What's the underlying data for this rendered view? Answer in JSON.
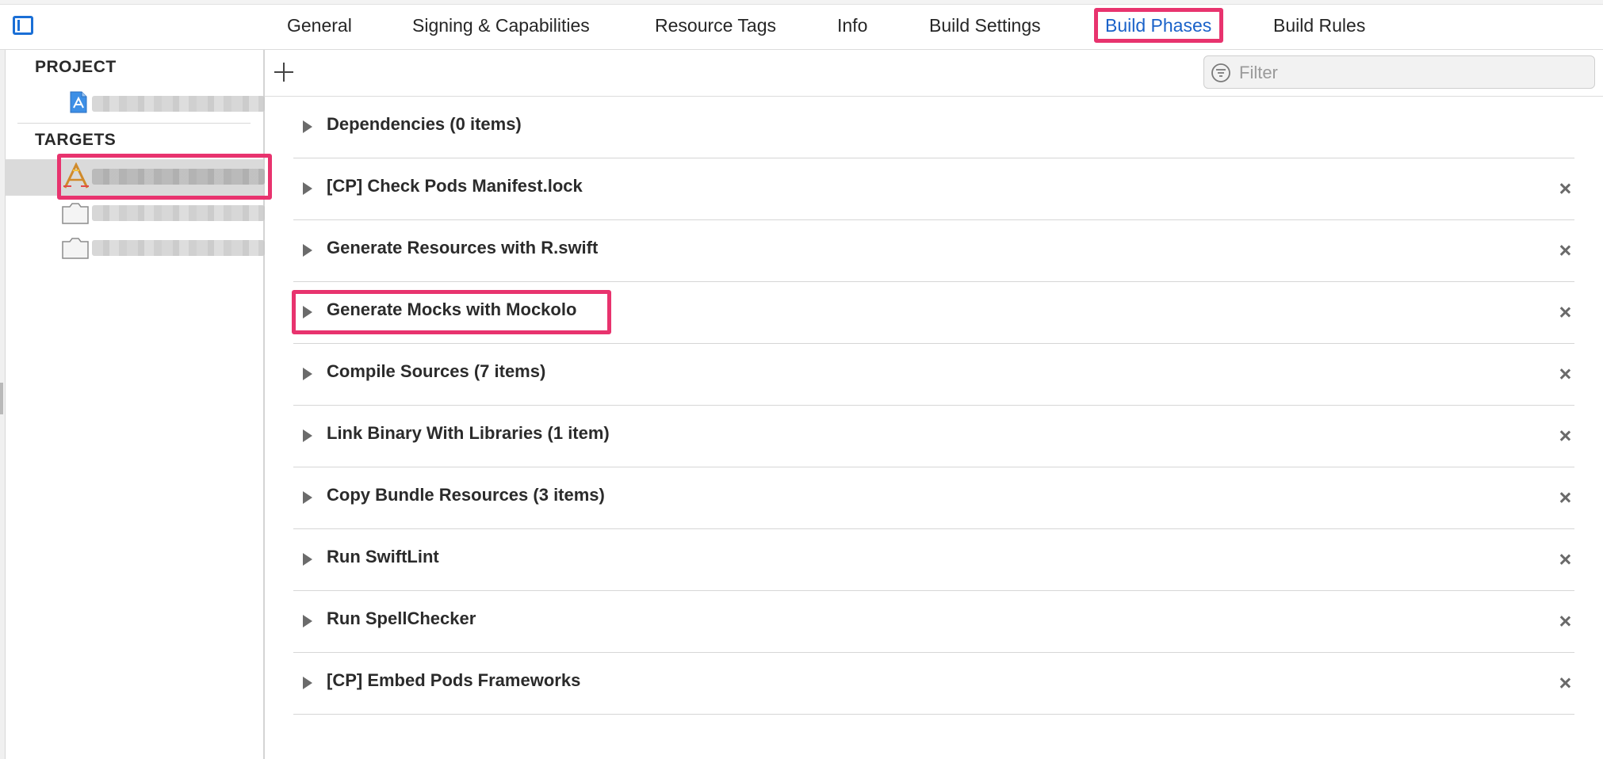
{
  "tabs": [
    {
      "label": "General"
    },
    {
      "label": "Signing & Capabilities"
    },
    {
      "label": "Resource Tags"
    },
    {
      "label": "Info"
    },
    {
      "label": "Build Settings"
    },
    {
      "label": "Build Phases",
      "active": true
    },
    {
      "label": "Build Rules"
    }
  ],
  "sidebar": {
    "project_header": "PROJECT",
    "targets_header": "TARGETS"
  },
  "filter": {
    "placeholder": "Filter"
  },
  "phases": [
    {
      "title": "Dependencies (0 items)",
      "removable": false
    },
    {
      "title": "[CP] Check Pods Manifest.lock",
      "removable": true
    },
    {
      "title": "Generate Resources with R.swift",
      "removable": true
    },
    {
      "title": "Generate Mocks with Mockolo",
      "removable": true
    },
    {
      "title": "Compile Sources (7 items)",
      "removable": true
    },
    {
      "title": "Link Binary With Libraries (1 item)",
      "removable": true
    },
    {
      "title": "Copy Bundle Resources (3 items)",
      "removable": true
    },
    {
      "title": "Run SwiftLint",
      "removable": true
    },
    {
      "title": "Run SpellChecker",
      "removable": true
    },
    {
      "title": "[CP] Embed Pods Frameworks",
      "removable": true
    }
  ],
  "colors": {
    "accent": "#1a62c9",
    "highlight": "#e8336e"
  },
  "icons": [
    "sidebar-toggle-icon",
    "project-file-icon",
    "app-target-icon",
    "bundle-target-icon",
    "add-icon",
    "filter-icon",
    "disclosure-triangle-icon",
    "close-icon"
  ]
}
